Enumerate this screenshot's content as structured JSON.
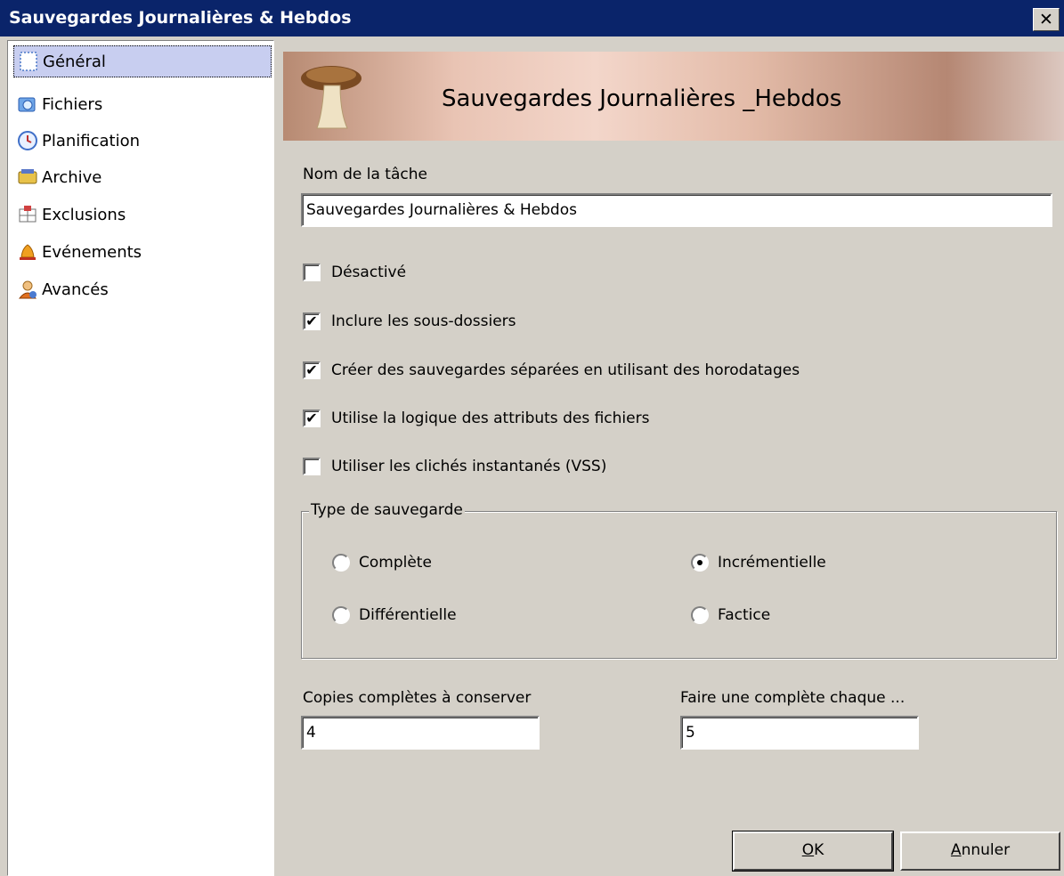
{
  "window": {
    "title": "Sauvegardes Journalières & Hebdos",
    "close_label": "✕"
  },
  "sidebar": {
    "items": [
      {
        "label": "Général",
        "icon": "general-icon",
        "selected": true
      },
      {
        "label": "Fichiers",
        "icon": "files-icon"
      },
      {
        "label": "Planification",
        "icon": "clock-icon"
      },
      {
        "label": "Archive",
        "icon": "archive-icon"
      },
      {
        "label": "Exclusions",
        "icon": "exclusions-icon"
      },
      {
        "label": "Evénements",
        "icon": "bell-icon"
      },
      {
        "label": "Avancés",
        "icon": "user-settings-icon"
      }
    ]
  },
  "banner": {
    "title": "Sauvegardes Journalières _Hebdos",
    "icon": "mushroom-icon"
  },
  "task": {
    "name_label": "Nom de la tâche",
    "name_value": "Sauvegardes Journalières & Hebdos"
  },
  "options": [
    {
      "label": "Désactivé",
      "checked": false
    },
    {
      "label": "Inclure les sous-dossiers",
      "checked": true
    },
    {
      "label": "Créer des sauvegardes séparées en utilisant des horodatages",
      "checked": true
    },
    {
      "label": "Utilise la logique des attributs des fichiers",
      "checked": true
    },
    {
      "label": "Utiliser les clichés instantanés (VSS)",
      "checked": false
    }
  ],
  "backup_type": {
    "legend": "Type de sauvegarde",
    "options": [
      {
        "label": "Complète",
        "selected": false
      },
      {
        "label": "Incrémentielle",
        "selected": true
      },
      {
        "label": "Différentielle",
        "selected": false
      },
      {
        "label": "Factice",
        "selected": false
      }
    ]
  },
  "copies": {
    "label": "Copies complètes à conserver",
    "value": "4"
  },
  "full_every": {
    "label": "Faire une complète chaque ...",
    "value": "5"
  },
  "buttons": {
    "ok_prefix": "O",
    "ok_rest": "K",
    "cancel_prefix": "A",
    "cancel_rest": "nnuler"
  }
}
